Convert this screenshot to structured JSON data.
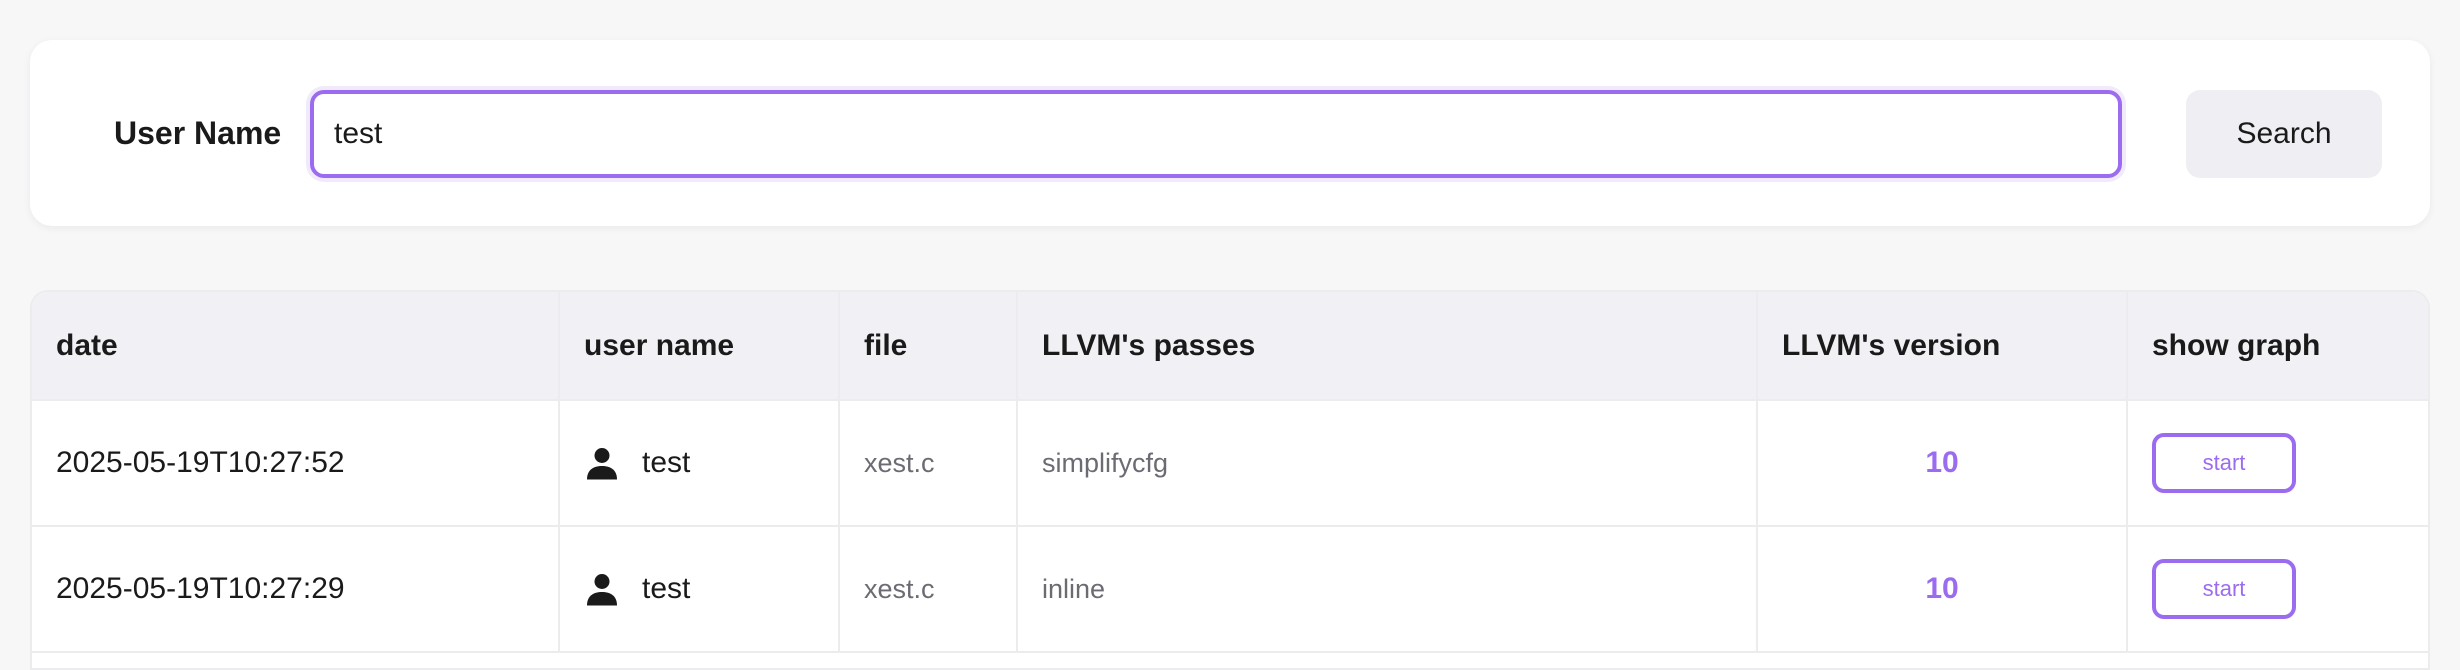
{
  "search": {
    "label": "User Name",
    "value": "test",
    "button_label": "Search"
  },
  "table": {
    "headers": {
      "date": "date",
      "user_name": "user name",
      "file": "file",
      "passes": "LLVM's passes",
      "version": "LLVM's version",
      "show_graph": "show graph"
    },
    "rows": [
      {
        "date": "2025-05-19T10:27:52",
        "user_name": "test",
        "user_icon": "user-icon",
        "file": "xest.c",
        "passes": "simplifycfg",
        "version": "10",
        "action": "start"
      },
      {
        "date": "2025-05-19T10:27:29",
        "user_name": "test",
        "user_icon": "user-icon",
        "file": "xest.c",
        "passes": "inline",
        "version": "10",
        "action": "start"
      }
    ]
  },
  "colors": {
    "accent": "#9b6cf0",
    "header_bg": "#f1f0f4",
    "button_bg": "#efeef3",
    "muted_text": "#6b6b73"
  }
}
